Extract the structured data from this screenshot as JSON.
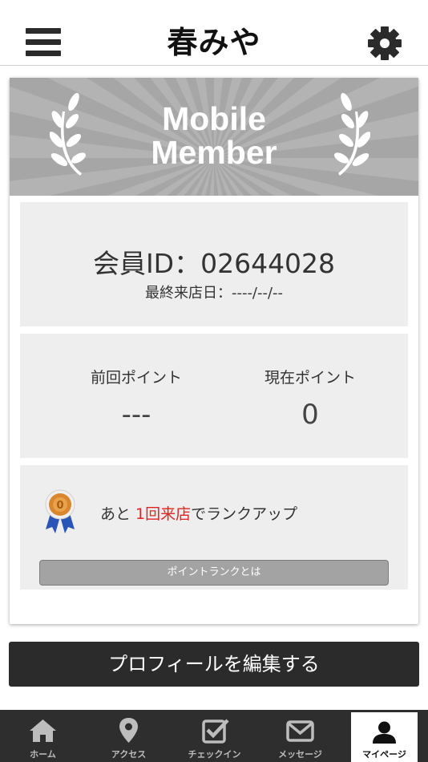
{
  "header": {
    "logo_text": "春みや"
  },
  "banner": {
    "title_line1": "Mobile",
    "title_line2": "Member"
  },
  "member": {
    "id_line": "会員ID：02644028",
    "last_visit": "最終来店日：----/--/--"
  },
  "points": {
    "previous_label": "前回ポイント",
    "previous_value": "---",
    "current_label": "現在ポイント",
    "current_value": "0"
  },
  "rank": {
    "text_before": "あと ",
    "text_highlight": "1回来店",
    "text_after": "でランクアップ",
    "medal_value": "0",
    "button_label": "ポイントランクとは"
  },
  "edit_profile_label": "プロフィールを編集する",
  "tabs": [
    {
      "label": "ホーム",
      "icon": "home-icon"
    },
    {
      "label": "アクセス",
      "icon": "map-pin-icon"
    },
    {
      "label": "チェックイン",
      "icon": "checkbox-icon"
    },
    {
      "label": "メッセージ",
      "icon": "envelope-icon"
    },
    {
      "label": "マイページ",
      "icon": "user-icon"
    }
  ],
  "colors": {
    "highlight": "#e02424",
    "dark": "#2b2b2b",
    "panel": "#eeeeee",
    "banner": "#a9a9a9"
  }
}
